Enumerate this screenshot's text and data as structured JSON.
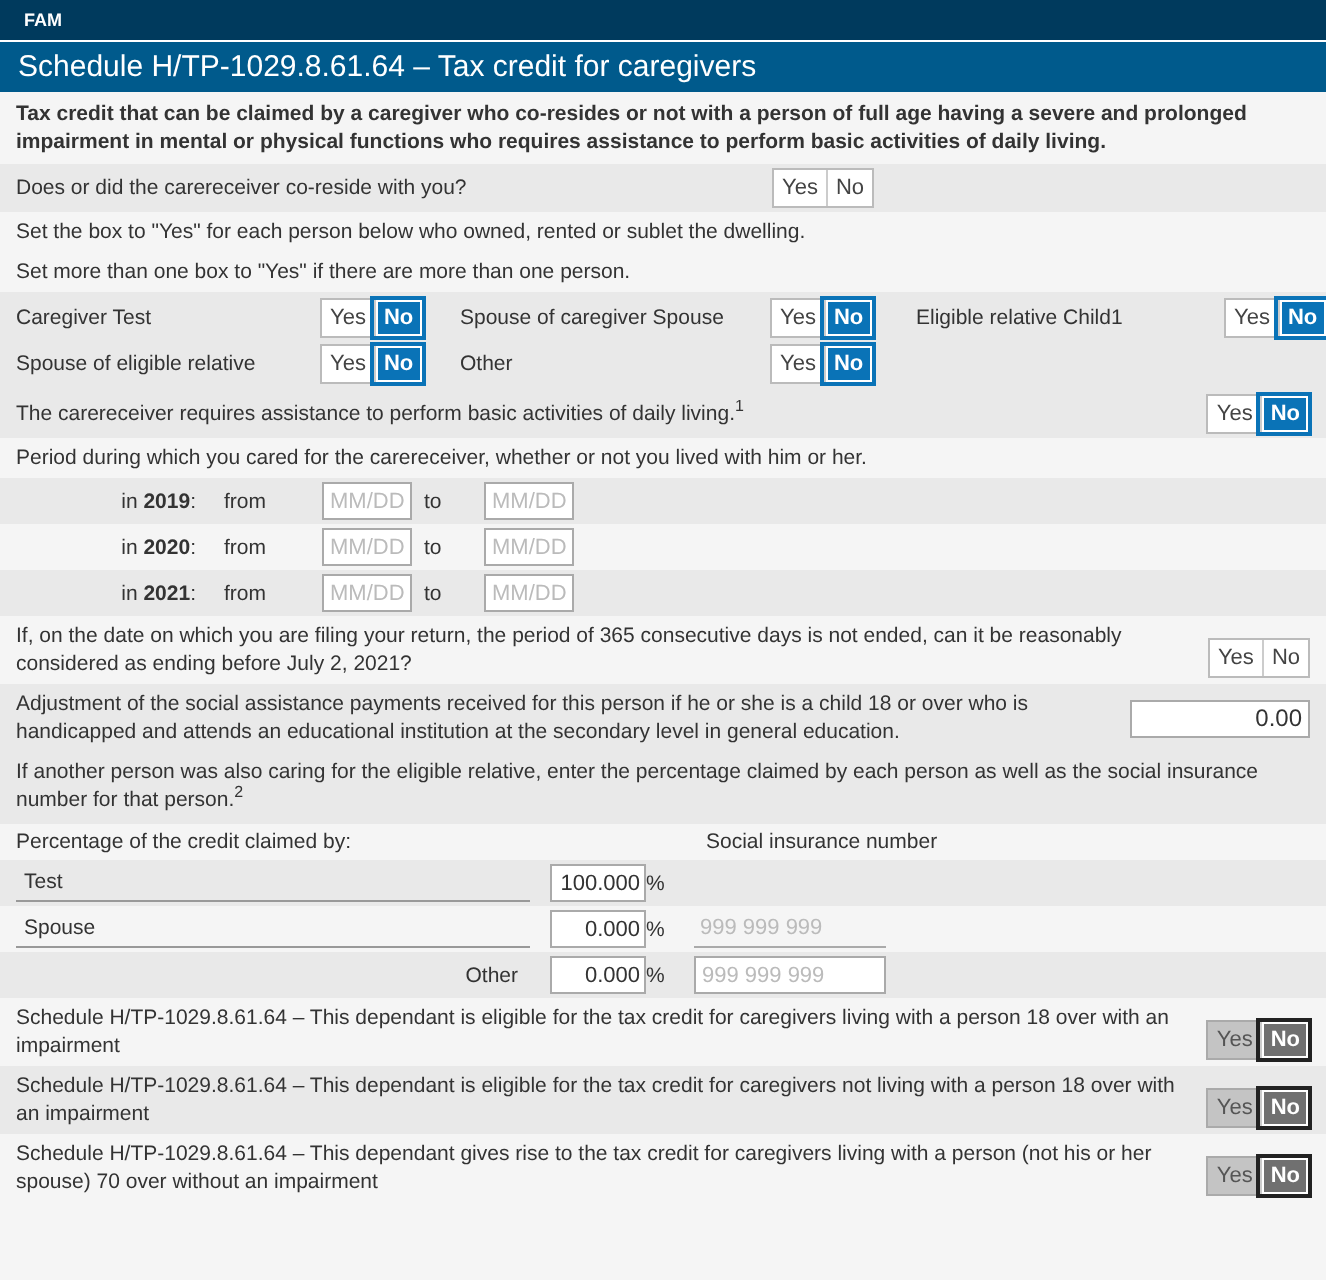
{
  "app_bar": {
    "label": "FAM"
  },
  "title": "Schedule H/TP-1029.8.61.64 – Tax credit for caregivers",
  "intro": "Tax credit that can be claimed by a caregiver who co-resides or not with a person of full age having a severe and prolonged impairment in mental or physical functions who requires assistance to perform basic activities of daily living.",
  "co_reside": {
    "question": "Does or did the carereceiver co-reside with you?",
    "toggle": {
      "disabled": false,
      "options": [
        {
          "label": "Yes",
          "selected": false
        },
        {
          "label": "No",
          "selected": false
        }
      ]
    }
  },
  "instructions": [
    "Set the box to \"Yes\" for each person below who owned, rented or sublet the dwelling.",
    "Set more than one box to \"Yes\" if there are more than one person."
  ],
  "persons": [
    {
      "label": "Caregiver Test",
      "toggle": {
        "disabled": false,
        "options": [
          {
            "label": "Yes",
            "selected": false
          },
          {
            "label": "No",
            "selected": true
          }
        ]
      }
    },
    {
      "label": "Spouse of caregiver Spouse",
      "toggle": {
        "disabled": false,
        "options": [
          {
            "label": "Yes",
            "selected": false
          },
          {
            "label": "No",
            "selected": true
          }
        ]
      }
    },
    {
      "label": "Eligible relative Child1",
      "toggle": {
        "disabled": false,
        "options": [
          {
            "label": "Yes",
            "selected": false
          },
          {
            "label": "No",
            "selected": true
          }
        ]
      }
    },
    {
      "label": "Spouse of eligible relative",
      "toggle": {
        "disabled": false,
        "options": [
          {
            "label": "Yes",
            "selected": false
          },
          {
            "label": "No",
            "selected": true
          }
        ]
      }
    },
    {
      "label": "Other",
      "toggle": {
        "disabled": false,
        "options": [
          {
            "label": "Yes",
            "selected": false
          },
          {
            "label": "No",
            "selected": true
          }
        ]
      }
    }
  ],
  "requires_assistance": {
    "question": "The carereceiver requires assistance to perform basic activities of daily living.$^{1}$",
    "toggle": {
      "disabled": false,
      "options": [
        {
          "label": "Yes",
          "selected": false
        },
        {
          "label": "No",
          "selected": true
        }
      ]
    }
  },
  "period": {
    "label": "Period during which you cared for the carereceiver, whether or not you lived with him or her.",
    "years": [
      {
        "year_label": "in **2019**:",
        "from_label": "from",
        "from": {
          "placeholder": "MM/DD"
        },
        "to_label": "to",
        "to": {
          "placeholder": "MM/DD"
        }
      },
      {
        "year_label": "in **2020**:",
        "from_label": "from",
        "from": {
          "placeholder": "MM/DD"
        },
        "to_label": "to",
        "to": {
          "placeholder": "MM/DD"
        }
      },
      {
        "year_label": "in **2021**:",
        "from_label": "from",
        "from": {
          "placeholder": "MM/DD"
        },
        "to_label": "to",
        "to": {
          "placeholder": "MM/DD"
        }
      }
    ]
  },
  "ending_question": {
    "question": "If, on the date on which you are filing your return, the period of 365 consecutive days is not ended, can it be reasonably considered as ending before July 2, 2021?",
    "toggle": {
      "disabled": false,
      "options": [
        {
          "label": "Yes",
          "selected": false
        },
        {
          "label": "No",
          "selected": false
        }
      ]
    }
  },
  "adjustment": {
    "label": "Adjustment of the social assistance payments received for this person if he or she is a child 18 or over who is handicapped and attends an educational institution at the secondary level in general education.",
    "value": "0.00"
  },
  "sharing_note": "If another person was also caring for the eligible relative, enter the percentage claimed by each person as well as the social insurance number for that person.$^{2}$",
  "percentage_header": "Percentage of the credit claimed by:",
  "sin_header": "Social insurance number",
  "claimants": [
    {
      "kind": "named",
      "name": "Test",
      "percent": "100.000",
      "unit": "%"
    },
    {
      "kind": "named",
      "name": "Spouse",
      "percent": "0.000",
      "unit": "%",
      "sin": {
        "placeholder": "999 999 999",
        "disabled": true
      }
    },
    {
      "kind": "other",
      "name": "Other",
      "percent": "0.000",
      "unit": "%",
      "sin": {
        "placeholder": "999 999 999",
        "disabled": false
      }
    }
  ],
  "eligibility": [
    {
      "text": "Schedule H/TP-1029.8.61.64 – This dependant is eligible for the tax credit for caregivers living with a person 18 over with an impairment",
      "toggle": {
        "disabled": true,
        "options": [
          {
            "label": "Yes",
            "selected": false
          },
          {
            "label": "No",
            "selected": true
          }
        ]
      }
    },
    {
      "text": "Schedule H/TP-1029.8.61.64 – This dependant is eligible for the tax credit for caregivers not living with a person 18 over with an impairment",
      "toggle": {
        "disabled": true,
        "options": [
          {
            "label": "Yes",
            "selected": false
          },
          {
            "label": "No",
            "selected": true
          }
        ]
      }
    },
    {
      "text": "Schedule H/TP-1029.8.61.64 – This dependant gives rise to the tax credit for caregivers living with a person (not his or her spouse) 70 over without an impairment",
      "toggle": {
        "disabled": true,
        "options": [
          {
            "label": "Yes",
            "selected": false
          },
          {
            "label": "No",
            "selected": true
          }
        ]
      }
    }
  ]
}
